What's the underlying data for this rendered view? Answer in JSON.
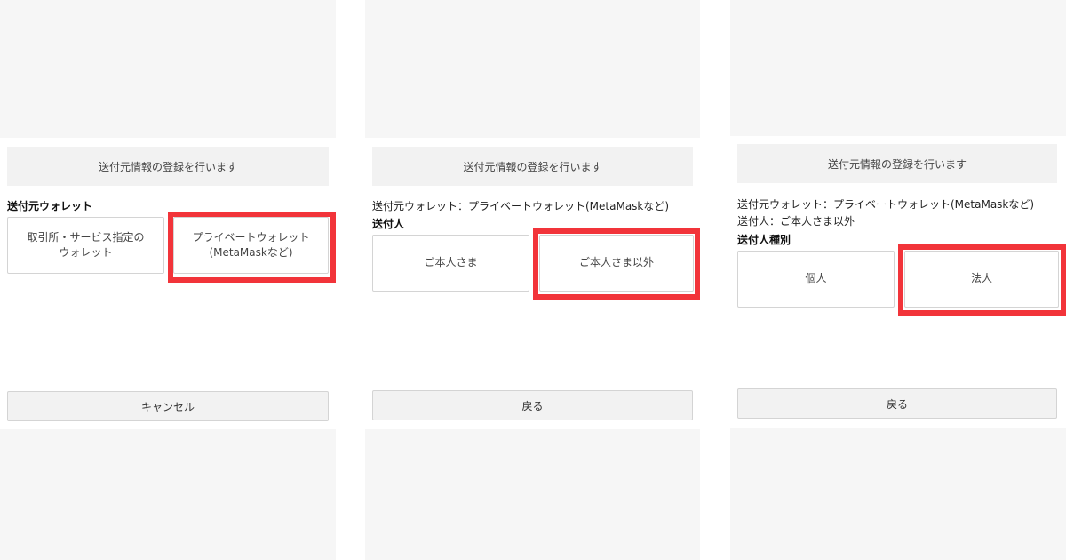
{
  "accent_color": "#f2343a",
  "panel1": {
    "header": "送付元情報の登録を行います",
    "section_label": "送付元ウォレット",
    "options": [
      "取引所・サービス指定の\nウォレット",
      "プライベートウォレット\n(MetaMaskなど)"
    ],
    "footer_button": "キャンセル"
  },
  "panel2": {
    "header": "送付元情報の登録を行います",
    "summary_wallet": "送付元ウォレット：プライベートウォレット(MetaMaskなど)",
    "section_label": "送付人",
    "options": [
      "ご本人さま",
      "ご本人さま以外"
    ],
    "footer_button": "戻る"
  },
  "panel3": {
    "header": "送付元情報の登録を行います",
    "summary_wallet": "送付元ウォレット：プライベートウォレット(MetaMaskなど)",
    "summary_sender": "送付人：ご本人さま以外",
    "section_label": "送付人種別",
    "options": [
      "個人",
      "法人"
    ],
    "footer_button": "戻る"
  }
}
